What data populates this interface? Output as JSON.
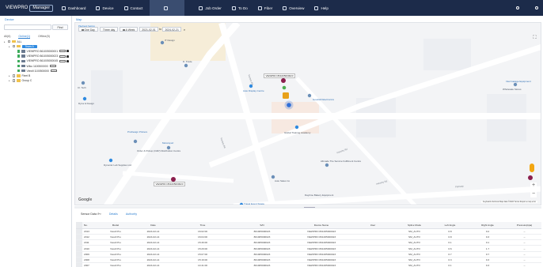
{
  "app": {
    "logo_prefix": "VIEWPRO",
    "logo_box": "Manager"
  },
  "nav": [
    {
      "label": "Dashboard",
      "icon": "dashboard-icon"
    },
    {
      "label": "Device",
      "icon": "device-icon"
    },
    {
      "label": "Contact",
      "icon": "contact-icon"
    },
    {
      "label": "",
      "icon": "map-icon",
      "active": true
    },
    {
      "label": "Job Order",
      "icon": "job-order-icon"
    },
    {
      "label": "To Do",
      "icon": "todo-icon"
    },
    {
      "label": "Fiber",
      "icon": "fiber-icon"
    },
    {
      "label": "Overview",
      "icon": "overview-icon"
    },
    {
      "label": "Help",
      "icon": "help-icon"
    }
  ],
  "top_right": {
    "user": "",
    "logout": ""
  },
  "left": {
    "title": "Device",
    "search_placeholder": "",
    "find_label": "Find",
    "tabs": [
      "All(6)",
      "Online(1)",
      "Offline(5)"
    ],
    "tree": [
      {
        "label": "ALL",
        "level": 0,
        "type": "folder"
      },
      {
        "label": "Team A",
        "level": 1,
        "type": "folder",
        "highlight": true
      },
      {
        "label": "VIEWPRO 861005000001",
        "level": 2,
        "type": "car",
        "checked": true
      },
      {
        "label": "VIEWPRO 861005000023",
        "level": 2,
        "type": "car",
        "checked": true
      },
      {
        "label": "VIEWPRO 861005000045",
        "level": 2,
        "type": "car",
        "checked": true
      },
      {
        "label": "Wiko 1100500000",
        "level": 2,
        "type": "car",
        "checked": true
      },
      {
        "label": "Viewfi 1100500000",
        "level": 2,
        "type": "car",
        "checked": true
      },
      {
        "label": "Fleet B",
        "level": 1,
        "type": "folder"
      },
      {
        "label": "Group C",
        "level": 1,
        "type": "folder"
      }
    ]
  },
  "map": {
    "title": "Map",
    "toolbar_label": "Playback Setting",
    "btn_one_day": "One Day",
    "btn_three_day": "Three day",
    "btn_week": "A Week",
    "date_from": "2021-02-01",
    "date_to": "2024-02-21",
    "to_label": "to",
    "google": "Google",
    "footer": "Keyboard shortcuts   Map data ©2024   Terms   Report a map error",
    "vehicle_labels": [
      "VIEWPRO 861005000023",
      "VIEWPRO 861005000023"
    ],
    "places": [
      {
        "t": "IT Design",
        "c": "gray"
      },
      {
        "t": "D. Trade",
        "c": "gray"
      },
      {
        "t": "Cl. Tech",
        "c": "gray"
      },
      {
        "t": "Dyna & Design",
        "c": "gray"
      },
      {
        "t": "Auto Display Centre",
        "c": "blue"
      },
      {
        "t": "Goodwill Electronics",
        "c": "blue"
      },
      {
        "t": "Global Training Academy",
        "c": "gray"
      },
      {
        "t": "ProDesign Printers",
        "c": "blue"
      },
      {
        "t": "Motorsport",
        "c": "blue"
      },
      {
        "t": "Order & Pickup (O&P) Distribution Centre",
        "c": "gray"
      },
      {
        "t": "Allmade Tire Service Fulfilment Centre",
        "c": "gray"
      },
      {
        "t": "Dynamic Lab Supplies Ltd",
        "c": "gray"
      },
      {
        "t": "Auto Sales Co",
        "c": "gray"
      },
      {
        "t": "Intel Garage Equipment",
        "c": "blue"
      },
      {
        "t": "Daytime Bakery Equipment",
        "c": "gray"
      },
      {
        "t": "Wholesale Stores",
        "c": "gray"
      },
      {
        "t": "Travel Event Space",
        "c": "blue"
      }
    ],
    "roads": [
      "Factory Rd",
      "Factory Rd",
      "Industry Rd",
      "Industry Rd",
      "Parkway"
    ]
  },
  "lower": {
    "label": "Sensor Data",
    "tabs": [
      "Details",
      "Authority"
    ],
    "columns": [
      "No.",
      "Model",
      "Date",
      "Time",
      "S/N",
      "Device Name",
      "User",
      "Splice Mode",
      "Left Angle",
      "Right Angle",
      "Pressure(kpa)"
    ],
    "rows": [
      [
        "2013",
        "Viewfi Pro",
        "2024-02-14",
        "16:02:00",
        "861005000023",
        "VIEWPRO 861005000023",
        "",
        "SM_AUTO",
        "0.8",
        "0.2",
        "--"
      ],
      [
        "2012",
        "Viewfi Pro",
        "2024-02-14",
        "16:04:00",
        "861005000023",
        "VIEWPRO 861005000023",
        "",
        "SM_AUTO",
        "0.8",
        "0.3",
        "--"
      ],
      [
        "2011",
        "Viewfi Pro",
        "2024-02-14",
        "15:46:00",
        "861005000023",
        "VIEWPRO 861005000023",
        "",
        "SM_AUTO",
        "0.1",
        "0.1",
        "--"
      ],
      [
        "2010",
        "Viewfi Pro",
        "2024-02-14",
        "15:29:00",
        "861005000023",
        "VIEWPRO 861005000023",
        "",
        "SM_AUTO",
        "0.6",
        "1.7",
        "--"
      ],
      [
        "2009",
        "Viewfi Pro",
        "2024-02-14",
        "15:07:00",
        "861005000023",
        "VIEWPRO 861005000023",
        "",
        "SM_AUTO",
        "0.7",
        "0.7",
        "--"
      ],
      [
        "2008",
        "Viewfi Pro",
        "2024-02-14",
        "15:16:00",
        "861005000023",
        "VIEWPRO 861005000023",
        "",
        "SM_AUTO",
        "0.3",
        "0.3",
        "--"
      ],
      [
        "2007",
        "Viewfi Pro",
        "2024-02-14",
        "14:41:00",
        "861005000023",
        "VIEWPRO 861005000023",
        "",
        "SM_AUTO",
        "0.1",
        "0.3",
        "--"
      ]
    ]
  }
}
